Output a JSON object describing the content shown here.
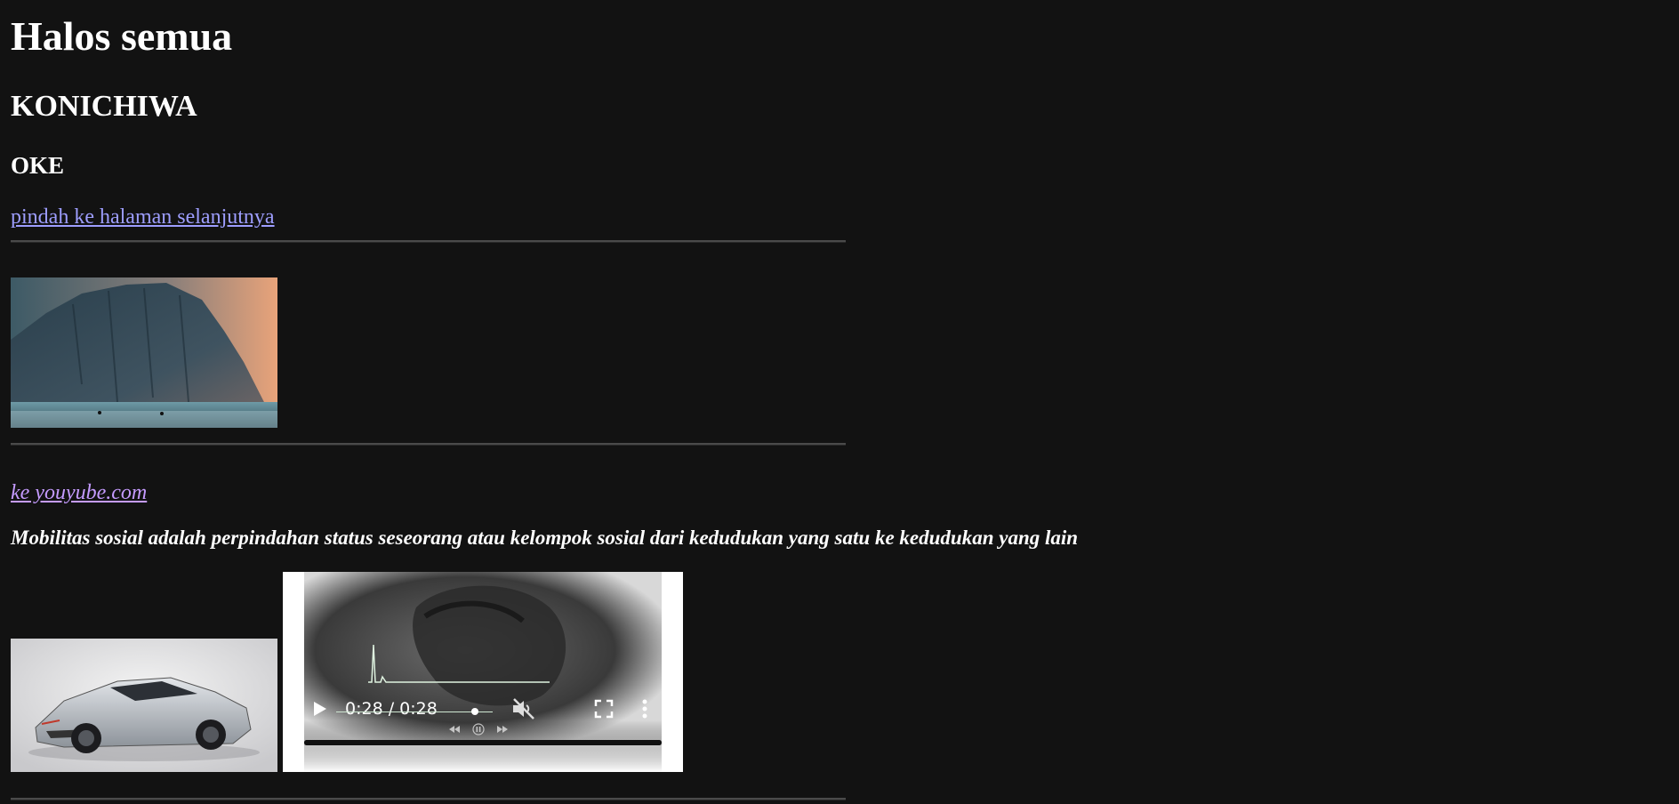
{
  "heading": {
    "h1": "Halos semua",
    "h2": "KONICHIWA",
    "h3": "OKE"
  },
  "links": {
    "next_page": "pindah ke halaman selanjutnya",
    "youtube": "ke youyube.com"
  },
  "paragraph": "Mobilitas sosial adalah perpindahan status seseorang atau kelompok sosial dari kedudukan yang satu ke kedudukan yang lain",
  "video": {
    "time_display": "0:28 / 0:28",
    "progress": 1.0,
    "muted": true
  },
  "icons": {
    "play": "play-icon",
    "mute": "muted-speaker-icon",
    "fullscreen": "fullscreen-icon",
    "menu": "kebab-menu-icon"
  },
  "colors": {
    "background": "#121212",
    "text": "#ffffff",
    "link": "#9e9eff",
    "visited_link": "#c59bff"
  }
}
